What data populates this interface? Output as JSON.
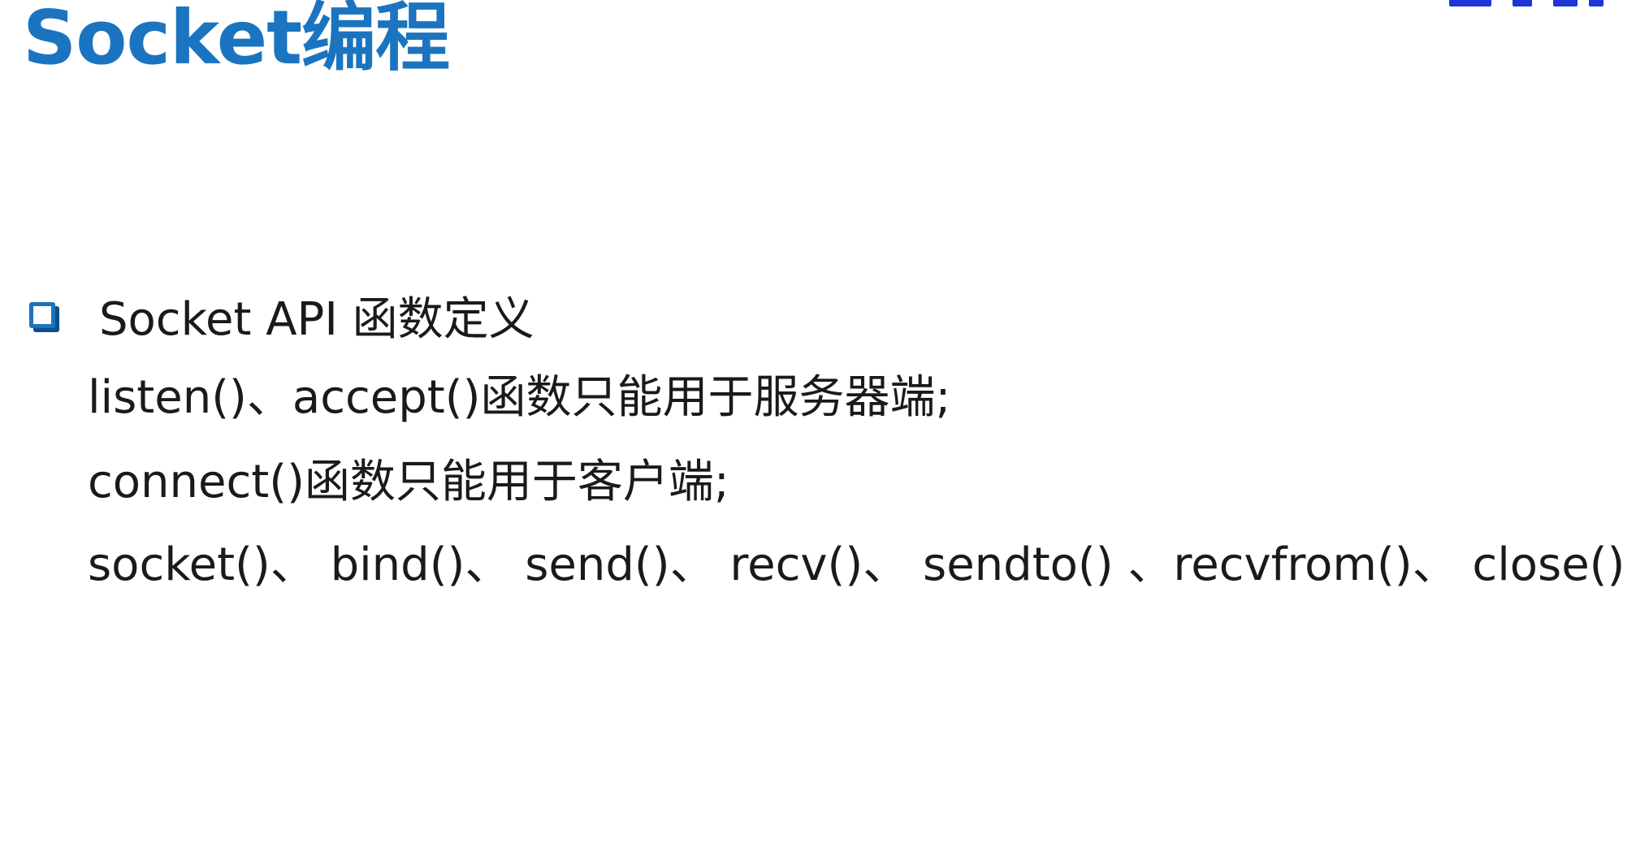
{
  "slide": {
    "title": "Socket编程",
    "section_heading": "Socket API 函数定义",
    "lines": [
      "listen()、accept()函数只能用于服务器端;",
      "connect()函数只能用于客户端;",
      "socket()、 bind()、 send()、 recv()、 sendto() 、recvfrom()、 close()"
    ]
  },
  "colors": {
    "title": "#1b74c0",
    "bullet": "#1b74c0",
    "body_text": "#1a1a1a",
    "corner_mark": "#1f35d6"
  },
  "icons": {
    "bullet": "checkbox-square-icon"
  }
}
